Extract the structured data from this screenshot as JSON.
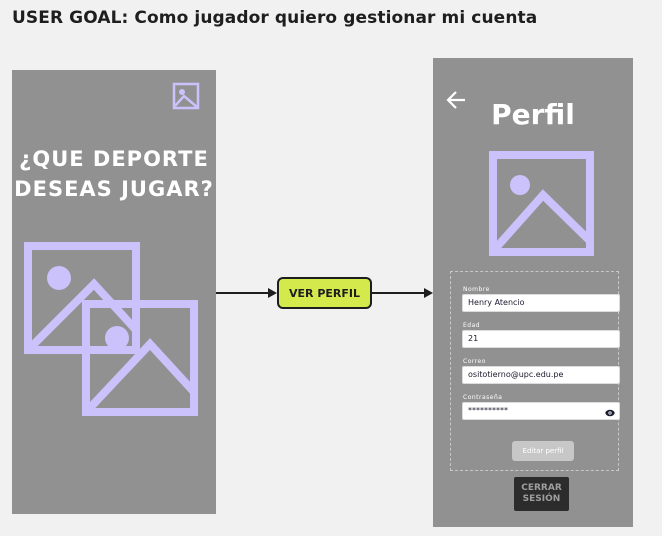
{
  "header": {
    "user_goal": "USER GOAL: Como jugador quiero gestionar mi cuenta"
  },
  "screen_home": {
    "question_line1": "¿QUE DEPORTE",
    "question_line2": "DESEAS JUGAR?",
    "icons": [
      "image-placeholder-icon",
      "image-placeholder-icon",
      "image-placeholder-icon"
    ]
  },
  "flow": {
    "action_label": "VER PERFIL"
  },
  "screen_profile": {
    "title": "Perfil",
    "back_icon": "arrow-left-icon",
    "fields": [
      {
        "label": "Nombre",
        "value": "Henry Atencio"
      },
      {
        "label": "Edad",
        "value": "21"
      },
      {
        "label": "Correo",
        "value": "ositotierno@upc.edu.pe"
      },
      {
        "label": "Contraseña",
        "value": "**********"
      }
    ],
    "edit_button": "Editar perfil",
    "logout_line1": "CERRAR",
    "logout_line2": "SESIÓN"
  },
  "colors": {
    "background": "#f1f1f1",
    "screen": "#919191",
    "placeholder": "#cbc1fb",
    "accent_button": "#d3e94c",
    "dark_button": "#2c2c2c"
  }
}
